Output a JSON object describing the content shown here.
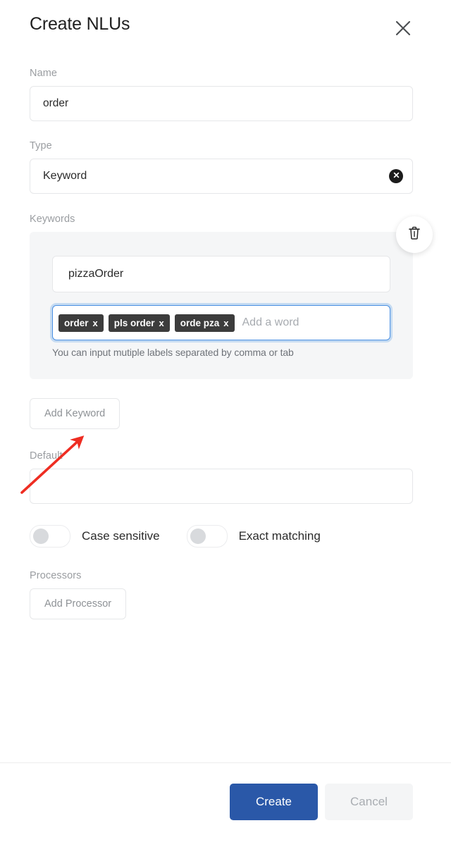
{
  "dialog": {
    "title": "Create NLUs",
    "close_icon": "close-icon"
  },
  "fields": {
    "name": {
      "label": "Name",
      "value": "order",
      "placeholder": ""
    },
    "type": {
      "label": "Type",
      "value": "Keyword",
      "clear_icon": "clear-circle-icon"
    },
    "keywords": {
      "label": "Keywords",
      "delete_icon": "trash-icon",
      "keyword_name": {
        "value": "pizzaOrder",
        "placeholder": ""
      },
      "tags": [
        {
          "label": "order",
          "remove": "x"
        },
        {
          "label": "pls order",
          "remove": "x"
        },
        {
          "label": "orde pza",
          "remove": "x"
        }
      ],
      "tag_input_placeholder": "Add a word",
      "hint": "You can input mutiple labels separated by comma or tab",
      "add_keyword_label": "Add Keyword"
    },
    "default": {
      "label": "Default",
      "value": "",
      "placeholder": ""
    },
    "toggles": [
      {
        "label": "Case sensitive",
        "state": "off"
      },
      {
        "label": "Exact matching",
        "state": "off"
      }
    ],
    "processors": {
      "label": "Processors",
      "add_processor_label": "Add Processor"
    }
  },
  "footer": {
    "create_label": "Create",
    "cancel_label": "Cancel"
  },
  "colors": {
    "primary_button": "#2a58a8",
    "tag_background": "#3c3c3c",
    "focus_border": "#4a90e2",
    "annotation_arrow": "#ee2d22",
    "label_text": "#9a9da1",
    "panel_background": "#f5f6f7"
  }
}
